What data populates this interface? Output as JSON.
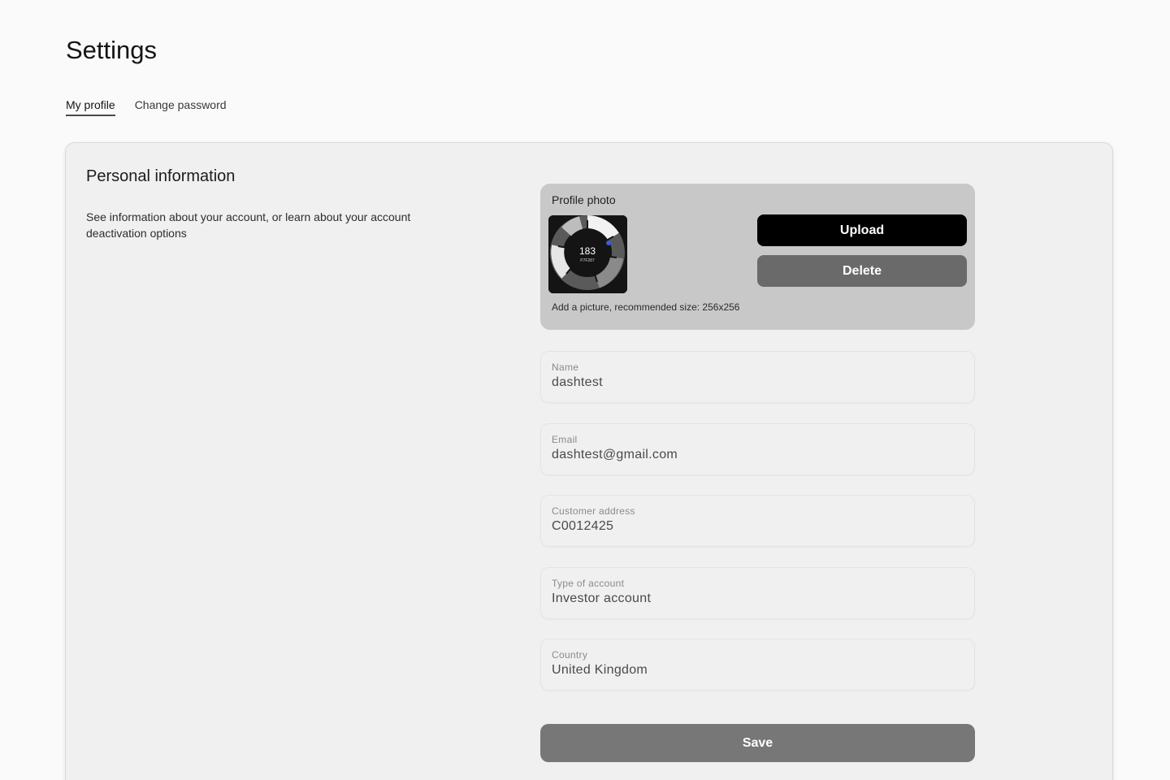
{
  "page": {
    "title": "Settings"
  },
  "tabs": [
    {
      "label": "My profile",
      "active": true
    },
    {
      "label": "Change password",
      "active": false
    }
  ],
  "personal": {
    "title": "Personal information",
    "description": "See information about your account, or learn about your account deactivation options"
  },
  "photo": {
    "label": "Profile photo",
    "hint": "Add a picture, recommended size: 256x256",
    "upload_label": "Upload",
    "delete_label": "Delete",
    "avatar": {
      "center_value": "183",
      "center_caption": "P7F287"
    }
  },
  "fields": [
    {
      "label": "Name",
      "value": "dashtest"
    },
    {
      "label": "Email",
      "value": "dashtest@gmail.com"
    },
    {
      "label": "Customer address",
      "value": "C0012425"
    },
    {
      "label": "Type of account",
      "value": "Investor account"
    },
    {
      "label": "Country",
      "value": "United Kingdom"
    }
  ],
  "save_label": "Save",
  "colors": {
    "primary_button": "#000000",
    "secondary_button": "#6a6a6a",
    "save_button": "#777777",
    "photo_panel": "#c9c8c9"
  }
}
